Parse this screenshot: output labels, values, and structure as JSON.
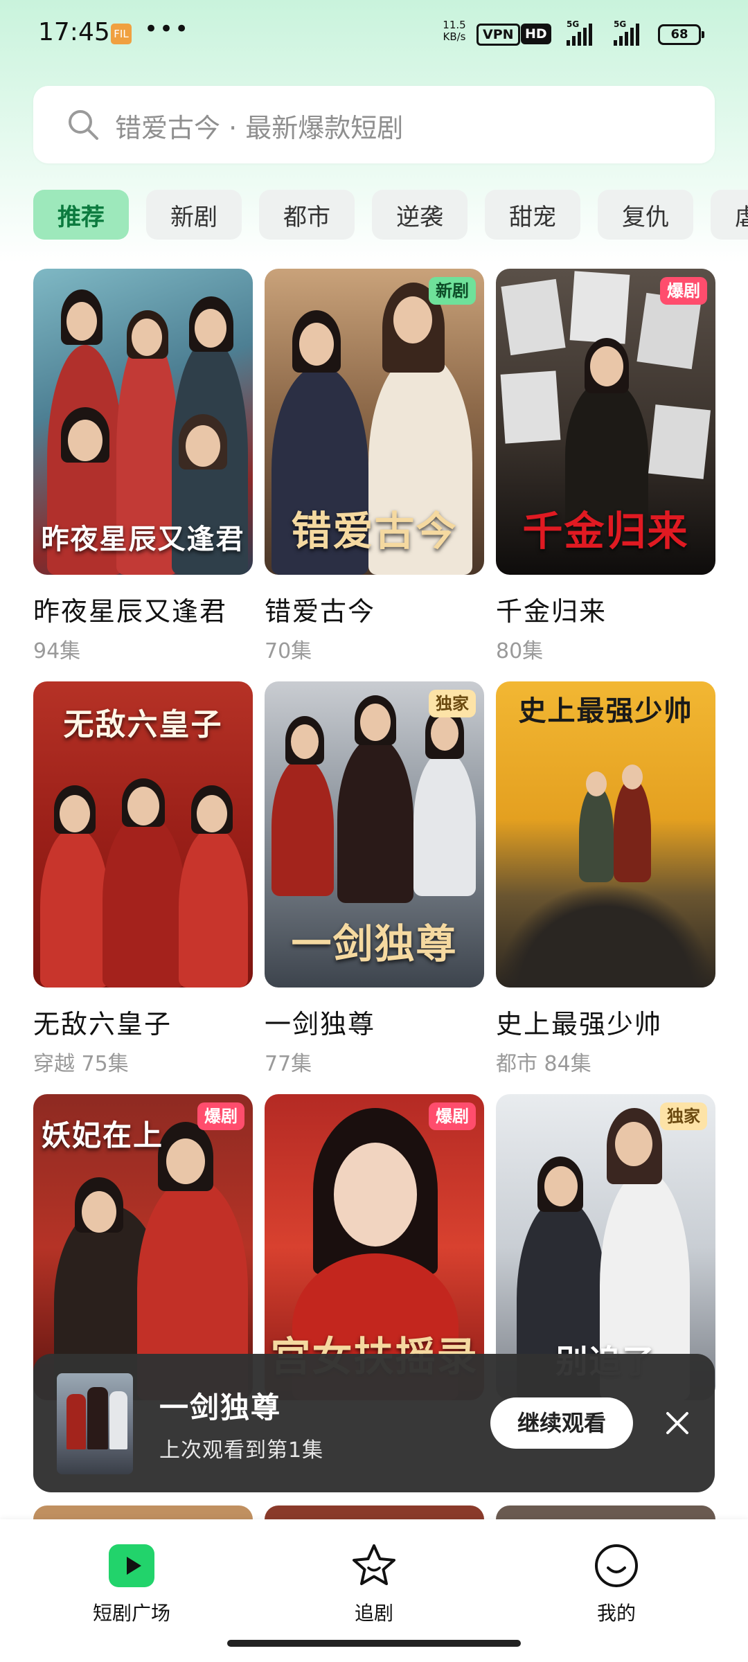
{
  "status_bar": {
    "time": "17:45",
    "app_badge": "FIL",
    "more": "•••",
    "net_rate_value": "11.5",
    "net_rate_unit": "KB/s",
    "vpn": "VPN",
    "hd": "HD",
    "sim1": "5G",
    "sim2": "5G",
    "battery": "68"
  },
  "search": {
    "placeholder": "错爱古今 · 最新爆款短剧"
  },
  "tabs": [
    "推荐",
    "新剧",
    "都市",
    "逆袭",
    "甜宠",
    "复仇",
    "虐恋"
  ],
  "active_tab": "推荐",
  "dramas": [
    {
      "title": "昨夜星辰又逢君",
      "meta": "94集",
      "tag": "",
      "poster_text": "昨夜星辰又逢君"
    },
    {
      "title": "错爱古今",
      "meta": "70集",
      "tag": "新剧",
      "poster_text": "错爱古今"
    },
    {
      "title": "千金归来",
      "meta": "80集",
      "tag": "爆剧",
      "poster_text": "千金归来"
    },
    {
      "title": "无敌六皇子",
      "meta": "穿越 75集",
      "tag": "",
      "poster_text": "无敌六皇子"
    },
    {
      "title": "一剑独尊",
      "meta": "77集",
      "tag": "独家",
      "poster_text": "一剑独尊"
    },
    {
      "title": "史上最强少帅",
      "meta": "都市 84集",
      "tag": "",
      "poster_text": "史上最强少帅"
    },
    {
      "title": "",
      "meta": "",
      "tag": "爆剧",
      "poster_text": "妖妃在上"
    },
    {
      "title": "",
      "meta": "",
      "tag": "爆剧",
      "poster_text": "宫女扶摇录"
    },
    {
      "title": "",
      "meta": "",
      "tag": "独家",
      "poster_text": "别追了"
    }
  ],
  "mini_player": {
    "title": "一剑独尊",
    "subtitle": "上次观看到第1集",
    "continue_label": "继续观看"
  },
  "bottom_nav": [
    {
      "label": "短剧广场"
    },
    {
      "label": "追剧"
    },
    {
      "label": "我的"
    }
  ],
  "colors": {
    "accent_green": "#22d36b",
    "active_tab_bg": "#9de8bb",
    "tag_new": "#6fe19a",
    "tag_hot": "#ff4d6d",
    "tag_exclusive": "#fde3a7"
  }
}
